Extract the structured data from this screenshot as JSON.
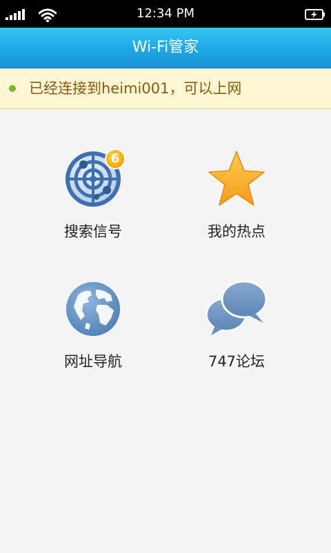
{
  "status_bar": {
    "time": "12:34 PM"
  },
  "header": {
    "title": "Wi-Fi管家"
  },
  "banner": {
    "message": "已经连接到heimi001，可以上网",
    "status_color": "#7ab82e"
  },
  "grid": {
    "items": [
      {
        "label": "搜索信号",
        "icon": "radar-icon",
        "badge": "6"
      },
      {
        "label": "我的热点",
        "icon": "star-icon"
      },
      {
        "label": "网址导航",
        "icon": "globe-icon"
      },
      {
        "label": "747论坛",
        "icon": "chat-bubbles-icon"
      }
    ]
  },
  "colors": {
    "title_bar": "#1fa7e6",
    "banner_bg": "#fff6d3",
    "banner_text": "#8a5a12",
    "icon_blue": "#4f86c0",
    "star": "#f9a825",
    "badge": "#f5a700"
  }
}
